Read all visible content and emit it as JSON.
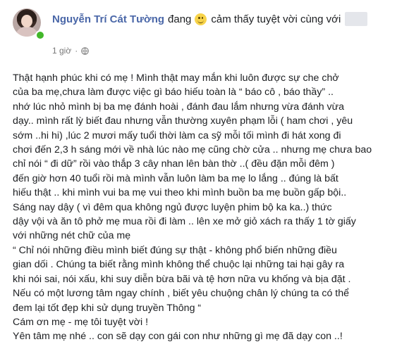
{
  "post": {
    "author": "Nguyễn Trí Cát Tường",
    "feeling_prefix": "đang",
    "feeling_icon": "smiling-face-icon",
    "feeling_text": "cảm thấy tuyệt vời cùng với",
    "time": "1 giờ",
    "separator": "·",
    "privacy_icon": "globe-icon",
    "colors": {
      "author_name": "#4a67a8",
      "text": "#1c1e21",
      "meta": "#777777",
      "online": "#42b72a",
      "emoji": "#f7d34a"
    },
    "lines": [
      "Thật hạnh phúc khi có mẹ ! Mình thật may mắn khi luôn được sự che chở",
      "của ba mẹ,chưa làm được việc gì báo hiếu toàn là “ báo cô , báo thầy” ..",
      "nhớ lúc nhỏ mình bị ba mẹ đánh hoài , đánh đau lắm nhưng vừa đánh vừa",
      "dạy.. mình rất lỳ biết đau nhưng vẫn thường xuyên phạm lỗi ( ham chơi , yêu",
      "sớm ..hi hi) ,lúc 2 mươi mấy tuổi thời làm ca sỹ mỗi tối mình đi hát xong đi",
      "chơi đến 2,3 h sáng mới về nhà lúc nào mẹ cũng chờ cửa .. nhưng mẹ chưa bao",
      "chỉ nói “ đi dữ” rồi vào thắp 3 cây nhan lên bàn thờ ..( đều đặn mỗi đêm )",
      "đến giờ hơn 40 tuổi rồi mà mình vẫn luôn làm ba mẹ lo lắng .. đúng là bất",
      "hiếu thật .. khi mình vui ba mẹ vui theo khi mình buồn ba mẹ buồn gấp bội..",
      "Sáng nay dậy ( vì đêm qua không ngủ được luyện phim bộ ka ka..) thức",
      "dậy vội và ăn tô phở mẹ mua rồi đi làm .. lên xe mở giỏ xách ra thấy 1 tờ giấy",
      "với những nét chữ của mẹ",
      "“ Chỉ nói những điều mình biết đúng sự thật - không phổ biến những điều",
      "gian dối . Chúng ta biết rằng mình không thể chuộc lại những tai hại gây ra",
      "khi nói sai, nói xấu, khi suy diễn bừa bãi và tệ hơn nữa vu khống và bịa đặt .",
      "Nếu có một lương tâm ngay chính , biết yêu chuộng chân lý chúng ta có thể",
      "đem lại tốt đẹp khi sử dụng truyền Thông “",
      "Cám ơn mẹ - mẹ tôi tuyệt vời !",
      "Yên tâm mẹ nhé .. con sẽ dạy con gái con như những gì mẹ đã dạy con ..!"
    ]
  }
}
